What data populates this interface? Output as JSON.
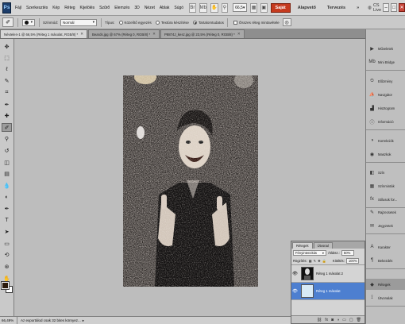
{
  "app": {
    "logo": "Ps",
    "menu": [
      "Fájl",
      "Szerkesztés",
      "Kép",
      "Réteg",
      "Kijelölés",
      "Szűrő",
      "Elemzés",
      "3D",
      "Nézet",
      "Ablak",
      "Súgó"
    ],
    "zoom_value": "66,5",
    "workspaces": {
      "active": "Saját",
      "items": [
        "Alapvető",
        "Tervezés"
      ]
    },
    "more_arrows": "»",
    "cs_live": "CS Live"
  },
  "options": {
    "mode_label": "Színmód:",
    "mode_value": "Normál",
    "tipus_label": "Típus:",
    "radio_1": "Közelítő egyezés",
    "radio_2": "Textúra készítése",
    "radio_3": "Tartalomtudatos",
    "sample_all_label": "Összes réteg mintavétele"
  },
  "tabs": [
    {
      "title": "Névtelen-1 @ 66,5% (Réteg 1 másolat, RGB/8) *",
      "active": true
    },
    {
      "title": "Beards.jpg @ 67% (Réteg 0, RGB/8) *",
      "active": false
    },
    {
      "title": "P8874J_kesz.jpg @ 23,5% (Réteg 0, RGB/8) *",
      "active": false
    }
  ],
  "toolbar": {
    "tools": [
      {
        "name": "move-tool",
        "glyph": "✥"
      },
      {
        "name": "marquee-tool",
        "glyph": "⬚"
      },
      {
        "name": "lasso-tool",
        "glyph": "ℓ"
      },
      {
        "name": "quick-select-tool",
        "glyph": "✎"
      },
      {
        "name": "crop-tool",
        "glyph": "⌗"
      },
      {
        "name": "eyedropper-tool",
        "glyph": "✒"
      },
      {
        "name": "healing-brush-tool",
        "glyph": "✚"
      },
      {
        "name": "brush-tool",
        "glyph": "✐"
      },
      {
        "name": "clone-stamp-tool",
        "glyph": "⚲"
      },
      {
        "name": "history-brush-tool",
        "glyph": "↺"
      },
      {
        "name": "eraser-tool",
        "glyph": "◫"
      },
      {
        "name": "gradient-tool",
        "glyph": "▤"
      },
      {
        "name": "blur-tool",
        "glyph": "💧"
      },
      {
        "name": "dodge-tool",
        "glyph": "◐"
      },
      {
        "name": "pen-tool",
        "glyph": "✒"
      },
      {
        "name": "type-tool",
        "glyph": "T"
      },
      {
        "name": "path-select-tool",
        "glyph": "➤"
      },
      {
        "name": "shape-tool",
        "glyph": "▭"
      },
      {
        "name": "3d-rotate-tool",
        "glyph": "⟲"
      },
      {
        "name": "3d-orbit-tool",
        "glyph": "⊛"
      },
      {
        "name": "hand-tool",
        "glyph": "✋"
      },
      {
        "name": "zoom-tool",
        "glyph": "⚲"
      }
    ],
    "active_tool": "brush-tool",
    "fg_color": "#2b1a0c",
    "bg_color": "#ffffff"
  },
  "status": {
    "zoom": "66,49%",
    "message": "Az exportálod csak 32 bites környez..."
  },
  "dock": {
    "groups": [
      [
        {
          "name": "muveletek",
          "label": "Műveletek",
          "icon": "▶"
        },
        {
          "name": "mini-bridge",
          "label": "Mini Bridge",
          "icon": "Mb"
        }
      ],
      [
        {
          "name": "elozmeny",
          "label": "Előzmény",
          "icon": "⏲"
        },
        {
          "name": "navigator",
          "label": "Navigátor",
          "icon": "⛵"
        },
        {
          "name": "hisztogram",
          "label": "Hisztogram",
          "icon": "▟"
        },
        {
          "name": "informacio",
          "label": "Információ",
          "icon": "ⓘ"
        }
      ],
      [
        {
          "name": "korrekciok",
          "label": "Korrekciók",
          "icon": "◑"
        },
        {
          "name": "maszkok",
          "label": "Maszkok",
          "icon": "◉"
        }
      ],
      [
        {
          "name": "szinek",
          "label": "Szín",
          "icon": "◧"
        },
        {
          "name": "szinmintak",
          "label": "Színminták",
          "icon": "▦"
        },
        {
          "name": "stilusok",
          "label": "Stílusok for...",
          "icon": "fx"
        }
      ],
      [
        {
          "name": "rajzecsetek",
          "label": "Rajzecsetek",
          "icon": "✎"
        },
        {
          "name": "jegyzetek",
          "label": "Jegyzetek",
          "icon": "✉"
        }
      ],
      [
        {
          "name": "karakter",
          "label": "Karakter",
          "icon": "A"
        },
        {
          "name": "bekezdes",
          "label": "Bekezdés",
          "icon": "¶"
        }
      ],
      [
        {
          "name": "retegek",
          "label": "Rétegek",
          "icon": "◆",
          "active": true
        },
        {
          "name": "utvonalak",
          "label": "Útvonalak",
          "icon": "⟟"
        }
      ]
    ]
  },
  "layers_panel": {
    "tabs": [
      "Rétegek",
      "Útvonal"
    ],
    "blend_mode": "Fényintenzitás",
    "opacity_label": "Átlátsz.:",
    "opacity_value": "50%",
    "lock_label": "Rögzítés:",
    "fill_label": "Kitöltés:",
    "fill_value": "100%",
    "layers": [
      {
        "name": "Réteg 1 másolat 2",
        "selected": false
      },
      {
        "name": "Réteg 1 másolat",
        "selected": true
      }
    ]
  }
}
